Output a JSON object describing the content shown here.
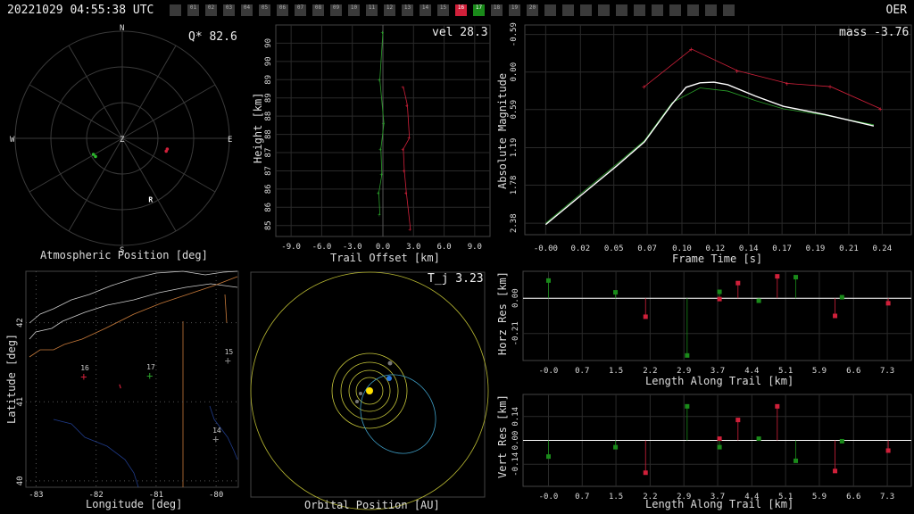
{
  "header": {
    "timestamp": "20221029 04:55:38 UTC",
    "station": "OER",
    "camera_slots": [
      "",
      "01",
      "02",
      "03",
      "04",
      "05",
      "06",
      "07",
      "08",
      "09",
      "10",
      "11",
      "12",
      "13",
      "14",
      "15",
      "16",
      "17",
      "18",
      "19",
      "20",
      "",
      "",
      "",
      "",
      "",
      "",
      "",
      "",
      "",
      "",
      ""
    ],
    "highlighted": {
      "16": "#d0203a",
      "17": "#1a8a1a"
    }
  },
  "chart_data": [
    {
      "id": "atmospheric",
      "type": "scatter",
      "title": "Q* 82.6",
      "xlabel": "Atmospheric Position [deg]",
      "compass": [
        "N",
        "E",
        "S",
        "W"
      ],
      "zenith_label": "Z",
      "radiant_label": "R",
      "series": [
        {
          "color": "#2db82d",
          "points": [
            [
              -0.27,
              -0.15
            ],
            [
              -0.25,
              -0.17
            ]
          ]
        },
        {
          "color": "#d0203a",
          "points": [
            [
              0.42,
              -0.1
            ],
            [
              0.41,
              -0.12
            ]
          ]
        }
      ],
      "radiant": [
        0.27,
        -0.57
      ]
    },
    {
      "id": "trail_height",
      "type": "line",
      "title": "vel 28.3",
      "xlabel": "Trail Offset [km]",
      "ylabel": "Height [km]",
      "xlim": [
        -10.5,
        10.5
      ],
      "ylim": [
        84.7,
        90.5
      ],
      "xticks": [
        "-9.0",
        "-6.0",
        "-3.0",
        "0.0",
        "3.0",
        "6.0",
        "9.0"
      ],
      "yticks": [
        "85",
        "86",
        "86",
        "87",
        "87",
        "88",
        "88",
        "89",
        "89",
        "90",
        "90"
      ],
      "series": [
        {
          "color": "#2aa02a",
          "points": [
            [
              0,
              90.3
            ],
            [
              -0.3,
              89.0
            ],
            [
              0.1,
              87.8
            ],
            [
              -0.2,
              87.1
            ],
            [
              -0.1,
              86.4
            ],
            [
              -0.4,
              85.9
            ],
            [
              -0.3,
              85.3
            ]
          ]
        },
        {
          "color": "#d0203a",
          "points": [
            [
              2.0,
              88.8
            ],
            [
              2.4,
              88.3
            ],
            [
              2.6,
              87.4
            ],
            [
              2.0,
              87.1
            ],
            [
              2.1,
              86.5
            ],
            [
              2.3,
              85.9
            ],
            [
              2.7,
              84.9
            ]
          ]
        }
      ]
    },
    {
      "id": "magnitude",
      "type": "line",
      "title": "mass -3.76",
      "xlabel": "Frame Time [s]",
      "ylabel": "Absolute Magnitude",
      "xlim": [
        -0.016,
        0.262
      ],
      "ylim": [
        2.56,
        -0.74
      ],
      "xticks": [
        "-0.00",
        "0.02",
        "0.05",
        "0.07",
        "0.10",
        "0.12",
        "0.14",
        "0.17",
        "0.19",
        "0.21",
        "0.24"
      ],
      "yticks": [
        "-0.59",
        "0.00",
        "0.59",
        "1.19",
        "1.78",
        "2.38"
      ],
      "series": [
        {
          "color": "#d0203a",
          "points": [
            [
              0.07,
              0.23
            ],
            [
              0.104,
              -0.36
            ],
            [
              0.137,
              -0.02
            ],
            [
              0.173,
              0.18
            ],
            [
              0.204,
              0.23
            ],
            [
              0.24,
              0.58
            ]
          ]
        },
        {
          "color": "#2aa02a",
          "points": [
            [
              -0.001,
              2.38
            ],
            [
              0.025,
              1.9
            ],
            [
              0.05,
              1.45
            ],
            [
              0.07,
              1.08
            ],
            [
              0.09,
              0.48
            ],
            [
              0.11,
              0.25
            ],
            [
              0.13,
              0.3
            ],
            [
              0.15,
              0.45
            ],
            [
              0.17,
              0.58
            ],
            [
              0.2,
              0.68
            ],
            [
              0.235,
              0.83
            ]
          ]
        },
        {
          "color": "#ffffff",
          "points": [
            [
              -0.001,
              2.4
            ],
            [
              0.025,
              1.93
            ],
            [
              0.05,
              1.48
            ],
            [
              0.07,
              1.1
            ],
            [
              0.09,
              0.5
            ],
            [
              0.1,
              0.24
            ],
            [
              0.11,
              0.17
            ],
            [
              0.12,
              0.16
            ],
            [
              0.13,
              0.2
            ],
            [
              0.15,
              0.38
            ],
            [
              0.17,
              0.54
            ],
            [
              0.2,
              0.67
            ],
            [
              0.235,
              0.85
            ]
          ]
        }
      ]
    },
    {
      "id": "map",
      "type": "scatter",
      "xlabel": "Longitude [deg]",
      "ylabel": "Latitude [deg]",
      "xlim": [
        -83.17,
        -79.63
      ],
      "ylim": [
        39.92,
        42.65
      ],
      "xticks": [
        "-83",
        "-82",
        "-81",
        "-80"
      ],
      "yticks": [
        "40",
        "41",
        "42"
      ],
      "stations": [
        {
          "label": "16",
          "lon": -82.2,
          "lat": 41.32,
          "color": "#d0203a"
        },
        {
          "label": "17",
          "lon": -81.1,
          "lat": 41.33,
          "color": "#2aa02a"
        },
        {
          "label": "15",
          "lon": -79.8,
          "lat": 41.52,
          "color": "#888888"
        },
        {
          "label": "14",
          "lon": -80.0,
          "lat": 40.53,
          "color": "#888888"
        }
      ],
      "track": [
        [
          -81.61,
          41.22
        ],
        [
          -81.59,
          41.17
        ]
      ]
    },
    {
      "id": "orbit",
      "type": "scatter",
      "title": "T_j 3.23",
      "xlabel": "Orbital Position [AU]"
    },
    {
      "id": "horz_res",
      "type": "scatter",
      "xlabel": "Length Along Trail [km]",
      "ylabel": "Horz Res [km]",
      "xlim": [
        -0.55,
        7.85
      ],
      "ylim": [
        -0.37,
        0.16
      ],
      "xticks": [
        "-0.0",
        "0.7",
        "1.5",
        "2.2",
        "2.9",
        "3.7",
        "4.4",
        "5.1",
        "5.9",
        "6.6",
        "7.3"
      ],
      "yticks": [
        "0.00",
        "-0.21"
      ],
      "series": [
        {
          "color": "#1a8a1a",
          "points": [
            [
              0,
              0.105
            ],
            [
              1.45,
              0.035
            ],
            [
              3.0,
              -0.34
            ],
            [
              3.7,
              0.038
            ],
            [
              4.55,
              -0.015
            ],
            [
              5.35,
              0.125
            ],
            [
              6.35,
              0.006
            ]
          ]
        },
        {
          "color": "#d0203a",
          "points": [
            [
              2.1,
              -0.11
            ],
            [
              3.7,
              -0.005
            ],
            [
              4.1,
              0.09
            ],
            [
              4.95,
              0.13
            ],
            [
              6.2,
              -0.105
            ],
            [
              7.35,
              -0.03
            ]
          ]
        }
      ]
    },
    {
      "id": "vert_res",
      "type": "scatter",
      "xlabel": "Length Along Trail [km]",
      "ylabel": "Vert Res [km]",
      "xlim": [
        -0.55,
        7.85
      ],
      "ylim": [
        -0.27,
        0.27
      ],
      "xticks": [
        "-0.0",
        "0.7",
        "1.5",
        "2.2",
        "2.9",
        "3.7",
        "4.4",
        "5.1",
        "5.9",
        "6.6",
        "7.3"
      ],
      "yticks": [
        "0.14",
        "0.00",
        "-0.14"
      ],
      "series": [
        {
          "color": "#1a8a1a",
          "points": [
            [
              0,
              -0.095
            ],
            [
              1.45,
              -0.04
            ],
            [
              3.0,
              0.2
            ],
            [
              3.7,
              -0.04
            ],
            [
              4.55,
              0.01
            ],
            [
              5.35,
              -0.12
            ],
            [
              6.35,
              -0.005
            ]
          ]
        },
        {
          "color": "#d0203a",
          "points": [
            [
              2.1,
              -0.19
            ],
            [
              3.7,
              0.01
            ],
            [
              4.1,
              0.12
            ],
            [
              4.95,
              0.2
            ],
            [
              6.2,
              -0.18
            ],
            [
              7.35,
              -0.06
            ]
          ]
        }
      ]
    }
  ]
}
